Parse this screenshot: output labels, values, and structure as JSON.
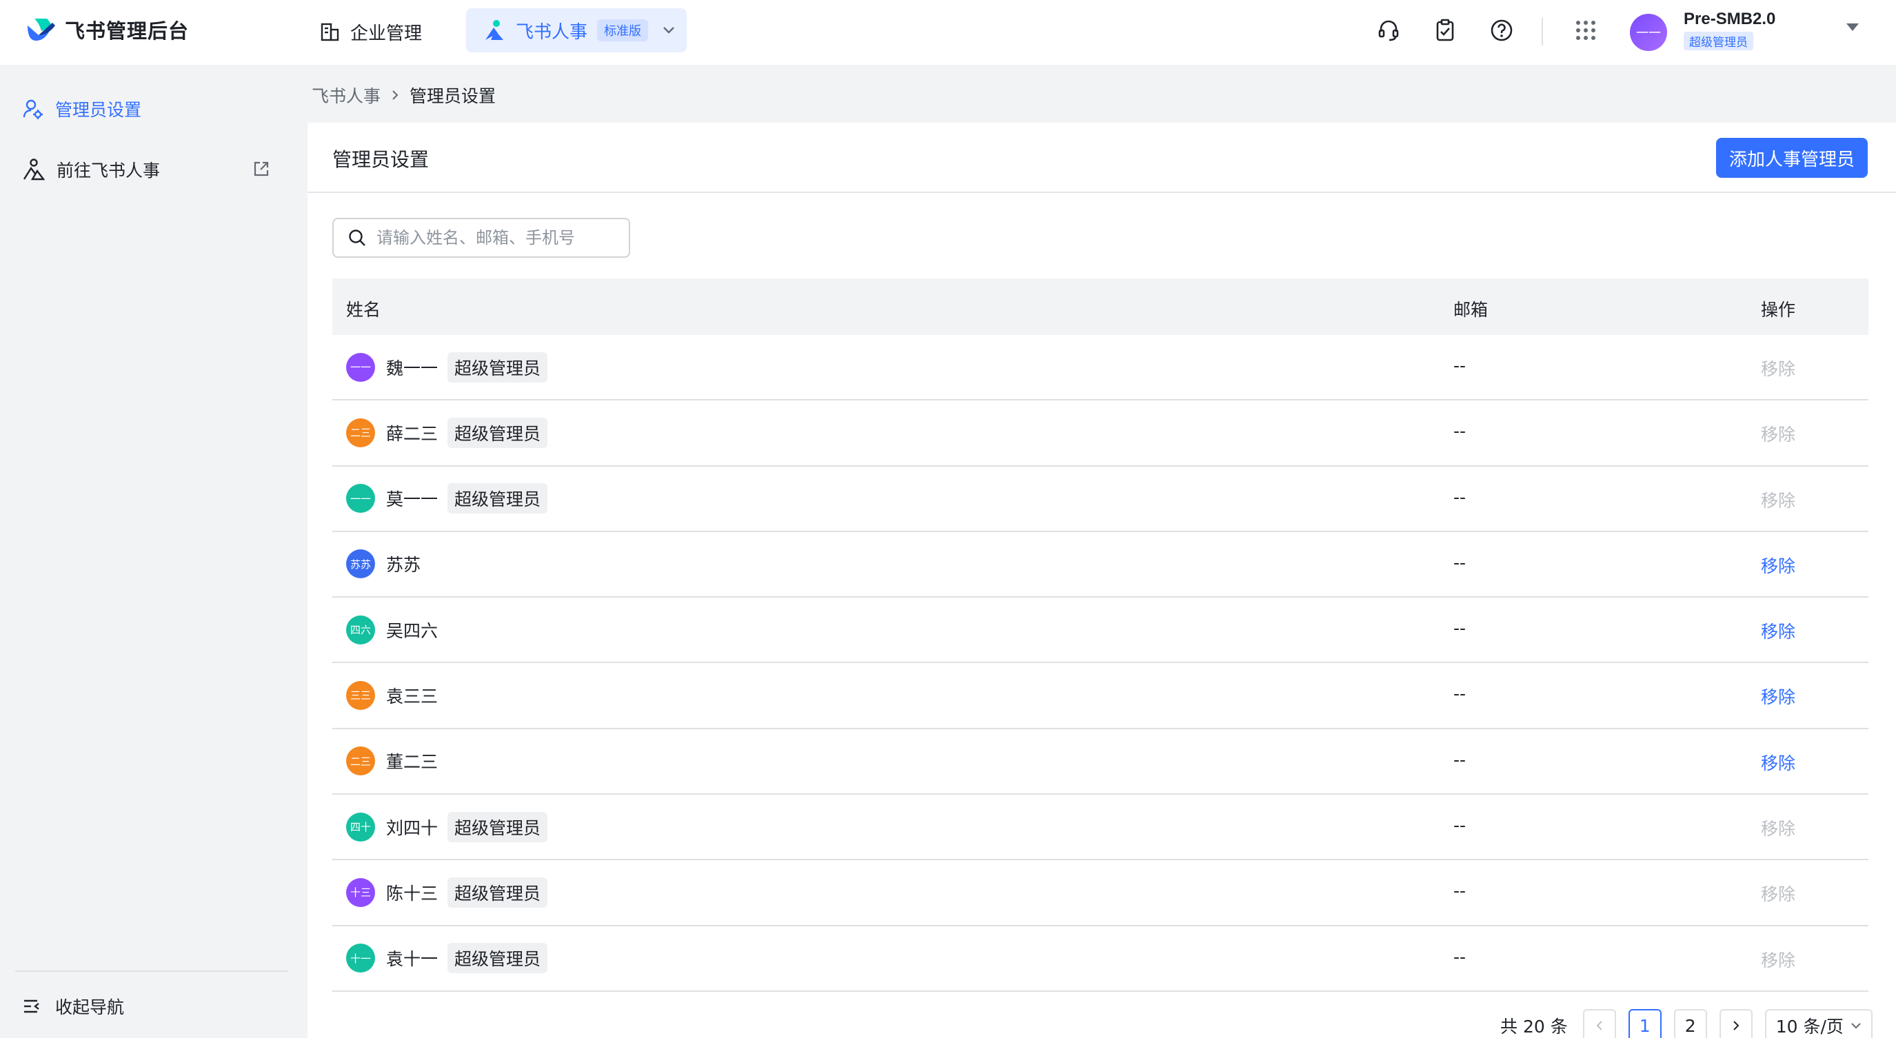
{
  "header": {
    "logo_text": "飞书管理后台",
    "nav_enterprise": "企业管理",
    "app_name": "飞书人事",
    "app_badge": "标准版",
    "tenant_name": "Pre-SMB2.0",
    "tenant_role": "超级管理员",
    "avatar_text": "一一"
  },
  "sidebar": {
    "items": [
      {
        "label": "管理员设置"
      },
      {
        "label": "前往飞书人事"
      }
    ],
    "collapse_label": "收起导航"
  },
  "breadcrumb": {
    "parent": "飞书人事",
    "current": "管理员设置"
  },
  "page": {
    "title": "管理员设置",
    "add_button": "添加人事管理员",
    "search_placeholder": "请输入姓名、邮箱、手机号"
  },
  "table": {
    "headers": {
      "name": "姓名",
      "email": "邮箱",
      "op": "操作"
    },
    "rows": [
      {
        "avatar": "一一",
        "color": "#8f4cff",
        "name": "魏一一",
        "tag": "超级管理员",
        "email": "--",
        "op": "移除",
        "op_enabled": false
      },
      {
        "avatar": "二三",
        "color": "#f5871f",
        "name": "薛二三",
        "tag": "超级管理员",
        "email": "--",
        "op": "移除",
        "op_enabled": false
      },
      {
        "avatar": "一一",
        "color": "#14c0a0",
        "name": "莫一一",
        "tag": "超级管理员",
        "email": "--",
        "op": "移除",
        "op_enabled": false
      },
      {
        "avatar": "苏苏",
        "color": "#3b6cf0",
        "name": "苏苏",
        "tag": "",
        "email": "--",
        "op": "移除",
        "op_enabled": true
      },
      {
        "avatar": "四六",
        "color": "#14c0a0",
        "name": "吴四六",
        "tag": "",
        "email": "--",
        "op": "移除",
        "op_enabled": true
      },
      {
        "avatar": "三三",
        "color": "#f5871f",
        "name": "袁三三",
        "tag": "",
        "email": "--",
        "op": "移除",
        "op_enabled": true
      },
      {
        "avatar": "二三",
        "color": "#f5871f",
        "name": "董二三",
        "tag": "",
        "email": "--",
        "op": "移除",
        "op_enabled": true
      },
      {
        "avatar": "四十",
        "color": "#14c0a0",
        "name": "刘四十",
        "tag": "超级管理员",
        "email": "--",
        "op": "移除",
        "op_enabled": false
      },
      {
        "avatar": "十三",
        "color": "#8f4cff",
        "name": "陈十三",
        "tag": "超级管理员",
        "email": "--",
        "op": "移除",
        "op_enabled": false
      },
      {
        "avatar": "十一",
        "color": "#14c0a0",
        "name": "袁十一",
        "tag": "超级管理员",
        "email": "--",
        "op": "移除",
        "op_enabled": false
      }
    ]
  },
  "pagination": {
    "total": "共 20 条",
    "pages": [
      "1",
      "2"
    ],
    "current": "1",
    "page_size": "10 条/页"
  },
  "colors": {
    "accent": "#3370ff",
    "disabled": "#bbbfc4"
  }
}
